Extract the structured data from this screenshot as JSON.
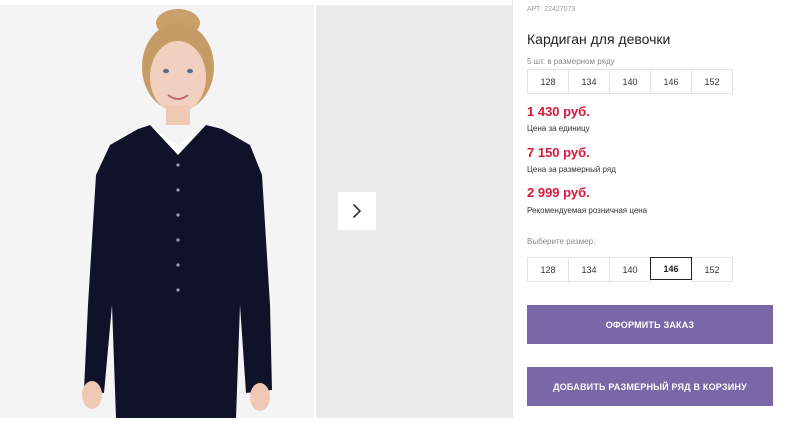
{
  "product": {
    "article": "АРТ: 22427073",
    "title": "Кардиган для девочки"
  },
  "size_row": {
    "label": "5 шт. в размерном ряду",
    "sizes": [
      "128",
      "134",
      "140",
      "146",
      "152"
    ]
  },
  "prices": [
    {
      "value": "1 430 руб.",
      "note": "Цена за единицу"
    },
    {
      "value": "7 150 руб.",
      "note": "Цена за размерный ряд"
    },
    {
      "value": "2 999 руб.",
      "note": "Рекомендуемая розничная цена"
    }
  ],
  "size_select": {
    "label": "Выберите размер:",
    "sizes": [
      "128",
      "134",
      "140",
      "146",
      "152"
    ],
    "selected": "146"
  },
  "buttons": {
    "order": "ОФОРМИТЬ ЗАКАЗ",
    "add_row": "ДОБАВИТЬ РАЗМЕРНЫЙ РЯД В КОРЗИНУ"
  },
  "gallery": {
    "next_icon": "chevron-right-icon"
  },
  "colors": {
    "accent": "#7a67a8",
    "price": "#d8163c"
  }
}
